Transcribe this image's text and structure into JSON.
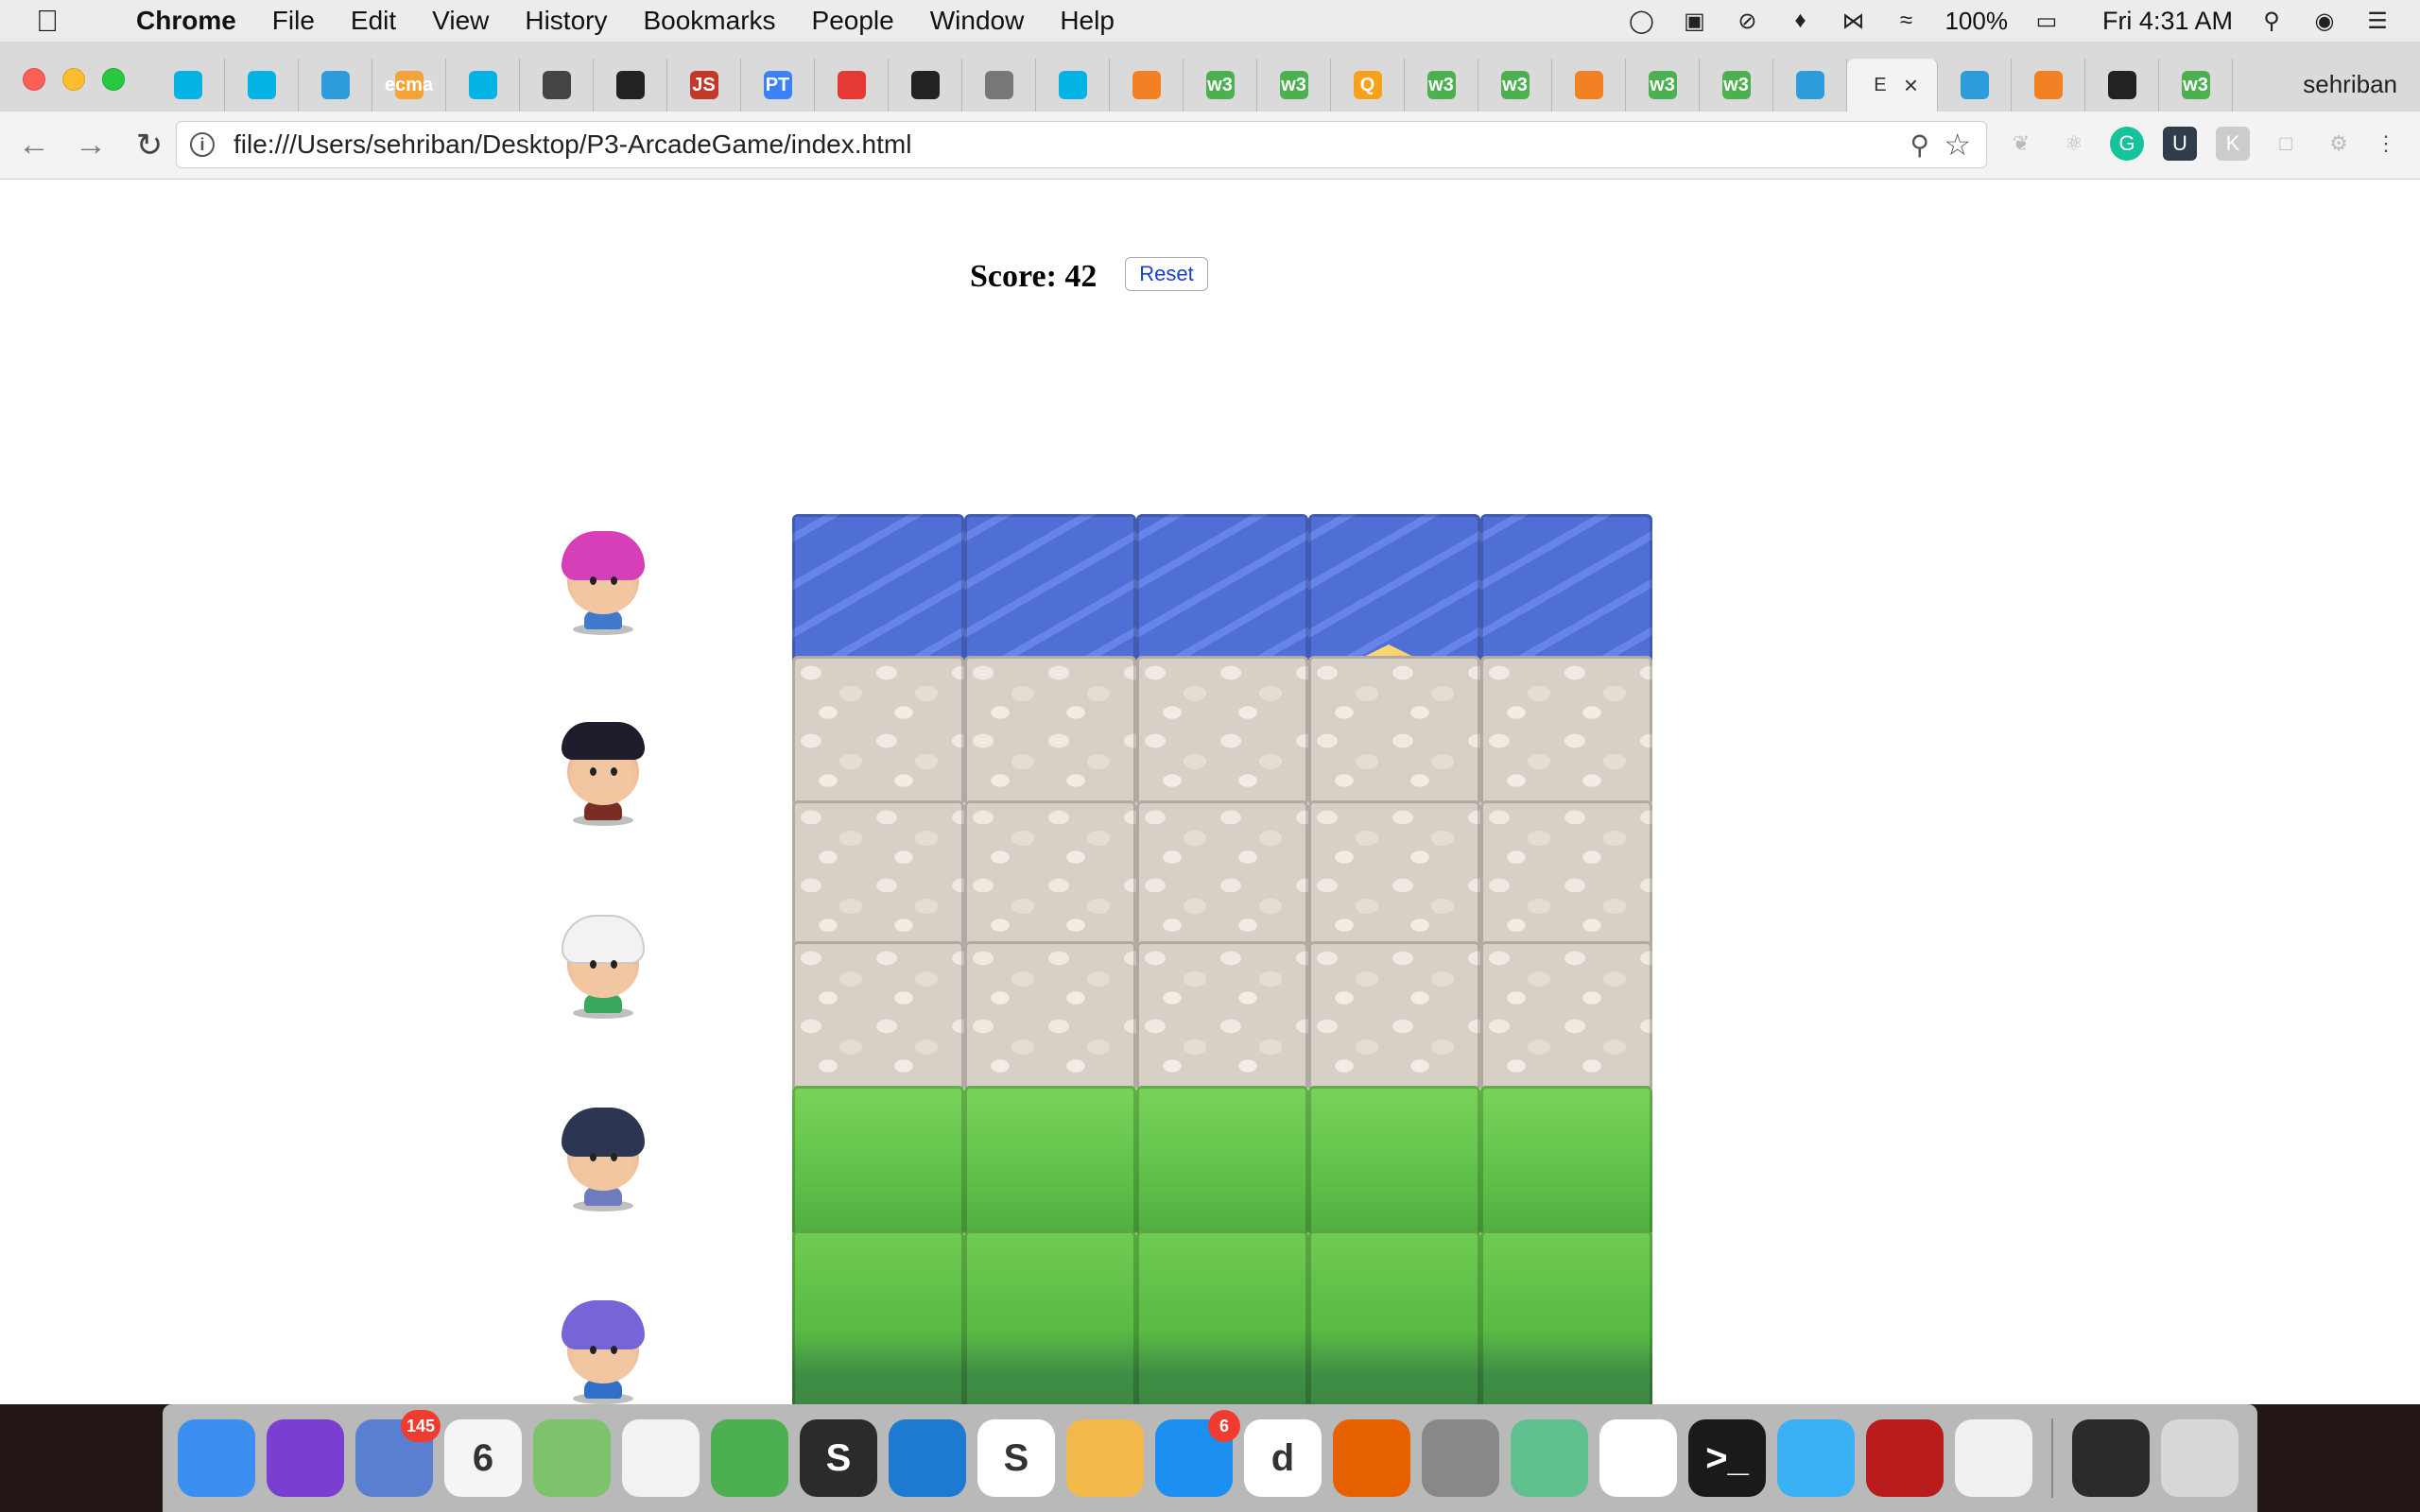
{
  "menubar": {
    "app": "Chrome",
    "items": [
      "File",
      "Edit",
      "View",
      "History",
      "Bookmarks",
      "People",
      "Window",
      "Help"
    ],
    "battery": "100%",
    "clock": "Fri 4:31 AM"
  },
  "tabs": [
    {
      "icon": "udacity-icon",
      "color": "#02b3e4"
    },
    {
      "icon": "udacity-icon",
      "color": "#02b3e4"
    },
    {
      "icon": "bear-icon",
      "color": "#2d9cdb"
    },
    {
      "icon": "ecma-icon",
      "color": "#f2a33a",
      "label": "ecma"
    },
    {
      "icon": "udacity-icon",
      "color": "#02b3e4"
    },
    {
      "icon": "swirl-icon",
      "color": "#444444"
    },
    {
      "icon": "codepen-icon",
      "color": "#222222"
    },
    {
      "icon": "js-icon",
      "color": "#c0392b",
      "label": "JS"
    },
    {
      "icon": "pt-icon",
      "color": "#3b82f6",
      "label": "PT"
    },
    {
      "icon": "figure-icon",
      "color": "#e53935"
    },
    {
      "icon": "codepen-icon",
      "color": "#222222"
    },
    {
      "icon": "doc-icon",
      "color": "#777777"
    },
    {
      "icon": "udacity-icon",
      "color": "#02b3e4"
    },
    {
      "icon": "stackoverflow-icon",
      "color": "#f48024"
    },
    {
      "icon": "w3-icon",
      "color": "#4caf50",
      "label": "w3"
    },
    {
      "icon": "w3-icon",
      "color": "#4caf50",
      "label": "w3"
    },
    {
      "icon": "search-q-icon",
      "color": "#f7a11a",
      "label": "Q"
    },
    {
      "icon": "w3-icon",
      "color": "#4caf50",
      "label": "w3"
    },
    {
      "icon": "w3-icon",
      "color": "#4caf50",
      "label": "w3"
    },
    {
      "icon": "stackoverflow-icon",
      "color": "#f48024"
    },
    {
      "icon": "w3-icon",
      "color": "#4caf50",
      "label": "w3"
    },
    {
      "icon": "w3-icon",
      "color": "#4caf50",
      "label": "w3"
    },
    {
      "icon": "bear-icon",
      "color": "#2d9cdb"
    },
    {
      "icon": "active-tab",
      "color": "#f3f3f3",
      "label": "E"
    },
    {
      "icon": "bear-icon",
      "color": "#2d9cdb"
    },
    {
      "icon": "stackoverflow-icon",
      "color": "#f48024"
    },
    {
      "icon": "github-icon",
      "color": "#222222"
    },
    {
      "icon": "w3-icon",
      "color": "#4caf50",
      "label": "w3"
    }
  ],
  "profile": "sehriban",
  "address": {
    "url": "file:///Users/sehriban/Desktop/P3-ArcadeGame/index.html"
  },
  "game": {
    "score_label": "Score: 42",
    "reset_label": "Reset",
    "avatars": [
      {
        "name": "char-pink-girl",
        "hair": "#d63fb8",
        "shirt": "#3f79c9"
      },
      {
        "name": "char-boy",
        "hair": "#1f1d2b",
        "shirt": "#7a2d22"
      },
      {
        "name": "char-cat-girl",
        "hair": "#f2f2f2",
        "shirt": "#38a860"
      },
      {
        "name": "char-horn-girl",
        "hair": "#2c3653",
        "shirt": "#6e7cbe"
      },
      {
        "name": "char-princess-girl",
        "hair": "#7565d6",
        "shirt": "#2f6fc7"
      }
    ],
    "rows": [
      "water",
      "stone",
      "stone",
      "stone",
      "grass",
      "grass"
    ],
    "columns": 5
  },
  "dock": {
    "apps": [
      {
        "name": "finder",
        "color": "#3b8ff0"
      },
      {
        "name": "siri",
        "color": "#7a3fd0"
      },
      {
        "name": "mail",
        "color": "#5a7fd0",
        "badge": "145"
      },
      {
        "name": "calendar",
        "color": "#f5f5f5",
        "label": "6"
      },
      {
        "name": "maps",
        "color": "#7ec36b"
      },
      {
        "name": "photos",
        "color": "#f2f2f2"
      },
      {
        "name": "evernote",
        "color": "#4caf50"
      },
      {
        "name": "sublime",
        "color": "#2b2b2b",
        "label": "S"
      },
      {
        "name": "brackets",
        "color": "#1e7ad0"
      },
      {
        "name": "slack-s",
        "color": "#ffffff",
        "label": "S"
      },
      {
        "name": "pages",
        "color": "#f2b84a"
      },
      {
        "name": "app-store",
        "color": "#1d8ff0",
        "badge": "6"
      },
      {
        "name": "d-app",
        "color": "#ffffff",
        "label": "d"
      },
      {
        "name": "firefox",
        "color": "#e66000"
      },
      {
        "name": "system-preferences",
        "color": "#888888"
      },
      {
        "name": "atom",
        "color": "#5fbf8f"
      },
      {
        "name": "chrome",
        "color": "#ffffff"
      },
      {
        "name": "terminal",
        "color": "#1a1a1a",
        "label": ">_"
      },
      {
        "name": "messages",
        "color": "#3ab0f5"
      },
      {
        "name": "acrobat",
        "color": "#b91c1c"
      },
      {
        "name": "itunes",
        "color": "#f1f1f1"
      },
      {
        "name": "screenshot-stack",
        "color": "#2b2b2b"
      },
      {
        "name": "trash",
        "color": "#d8d8d8"
      }
    ]
  }
}
